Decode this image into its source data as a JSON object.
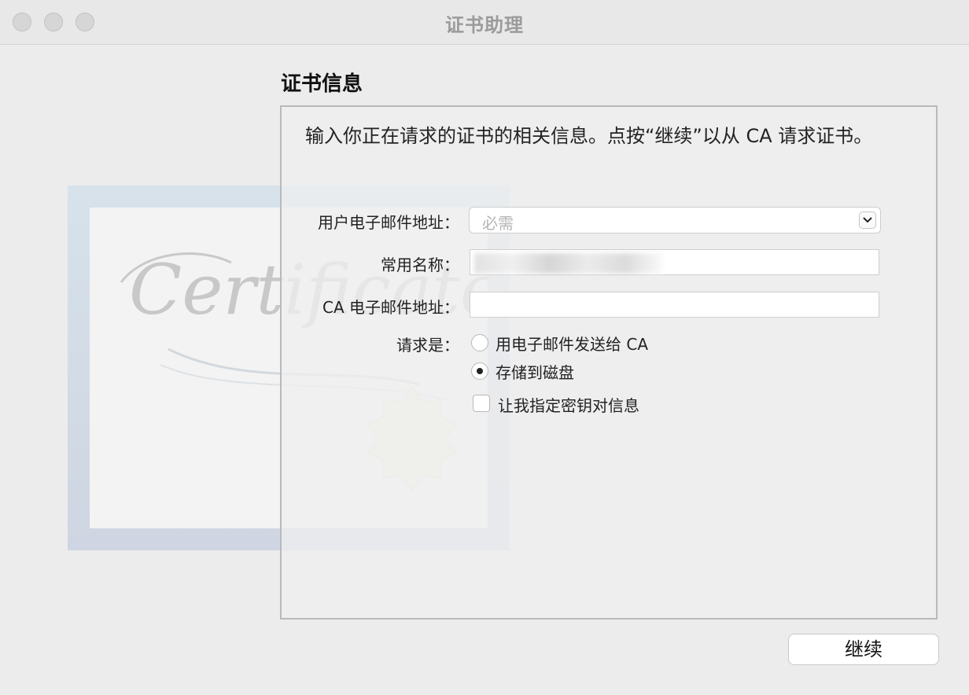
{
  "window": {
    "title": "证书助理"
  },
  "illustration": {
    "script_text": "Certificate"
  },
  "section": {
    "title": "证书信息"
  },
  "intro": {
    "text": "输入你正在请求的证书的相关信息。点按“继续”以从 CA 请求证书。"
  },
  "form": {
    "email": {
      "label": "用户电子邮件地址：",
      "placeholder": "必需",
      "value": ""
    },
    "common_name": {
      "label": "常用名称：",
      "value": ""
    },
    "ca_email": {
      "label": "CA 电子邮件地址：",
      "value": ""
    },
    "request": {
      "label": "请求是：",
      "options": [
        {
          "label": "用电子邮件发送给 CA",
          "selected": false
        },
        {
          "label": "存储到磁盘",
          "selected": true
        }
      ]
    },
    "custom_key": {
      "label": "让我指定密钥对信息",
      "checked": false
    }
  },
  "buttons": {
    "continue": "继续"
  },
  "icons": {
    "close": "window-close-icon",
    "minimize": "window-minimize-icon",
    "zoom": "window-zoom-icon",
    "dropdown": "chevron-down-icon",
    "seal": "certificate-seal-icon"
  }
}
